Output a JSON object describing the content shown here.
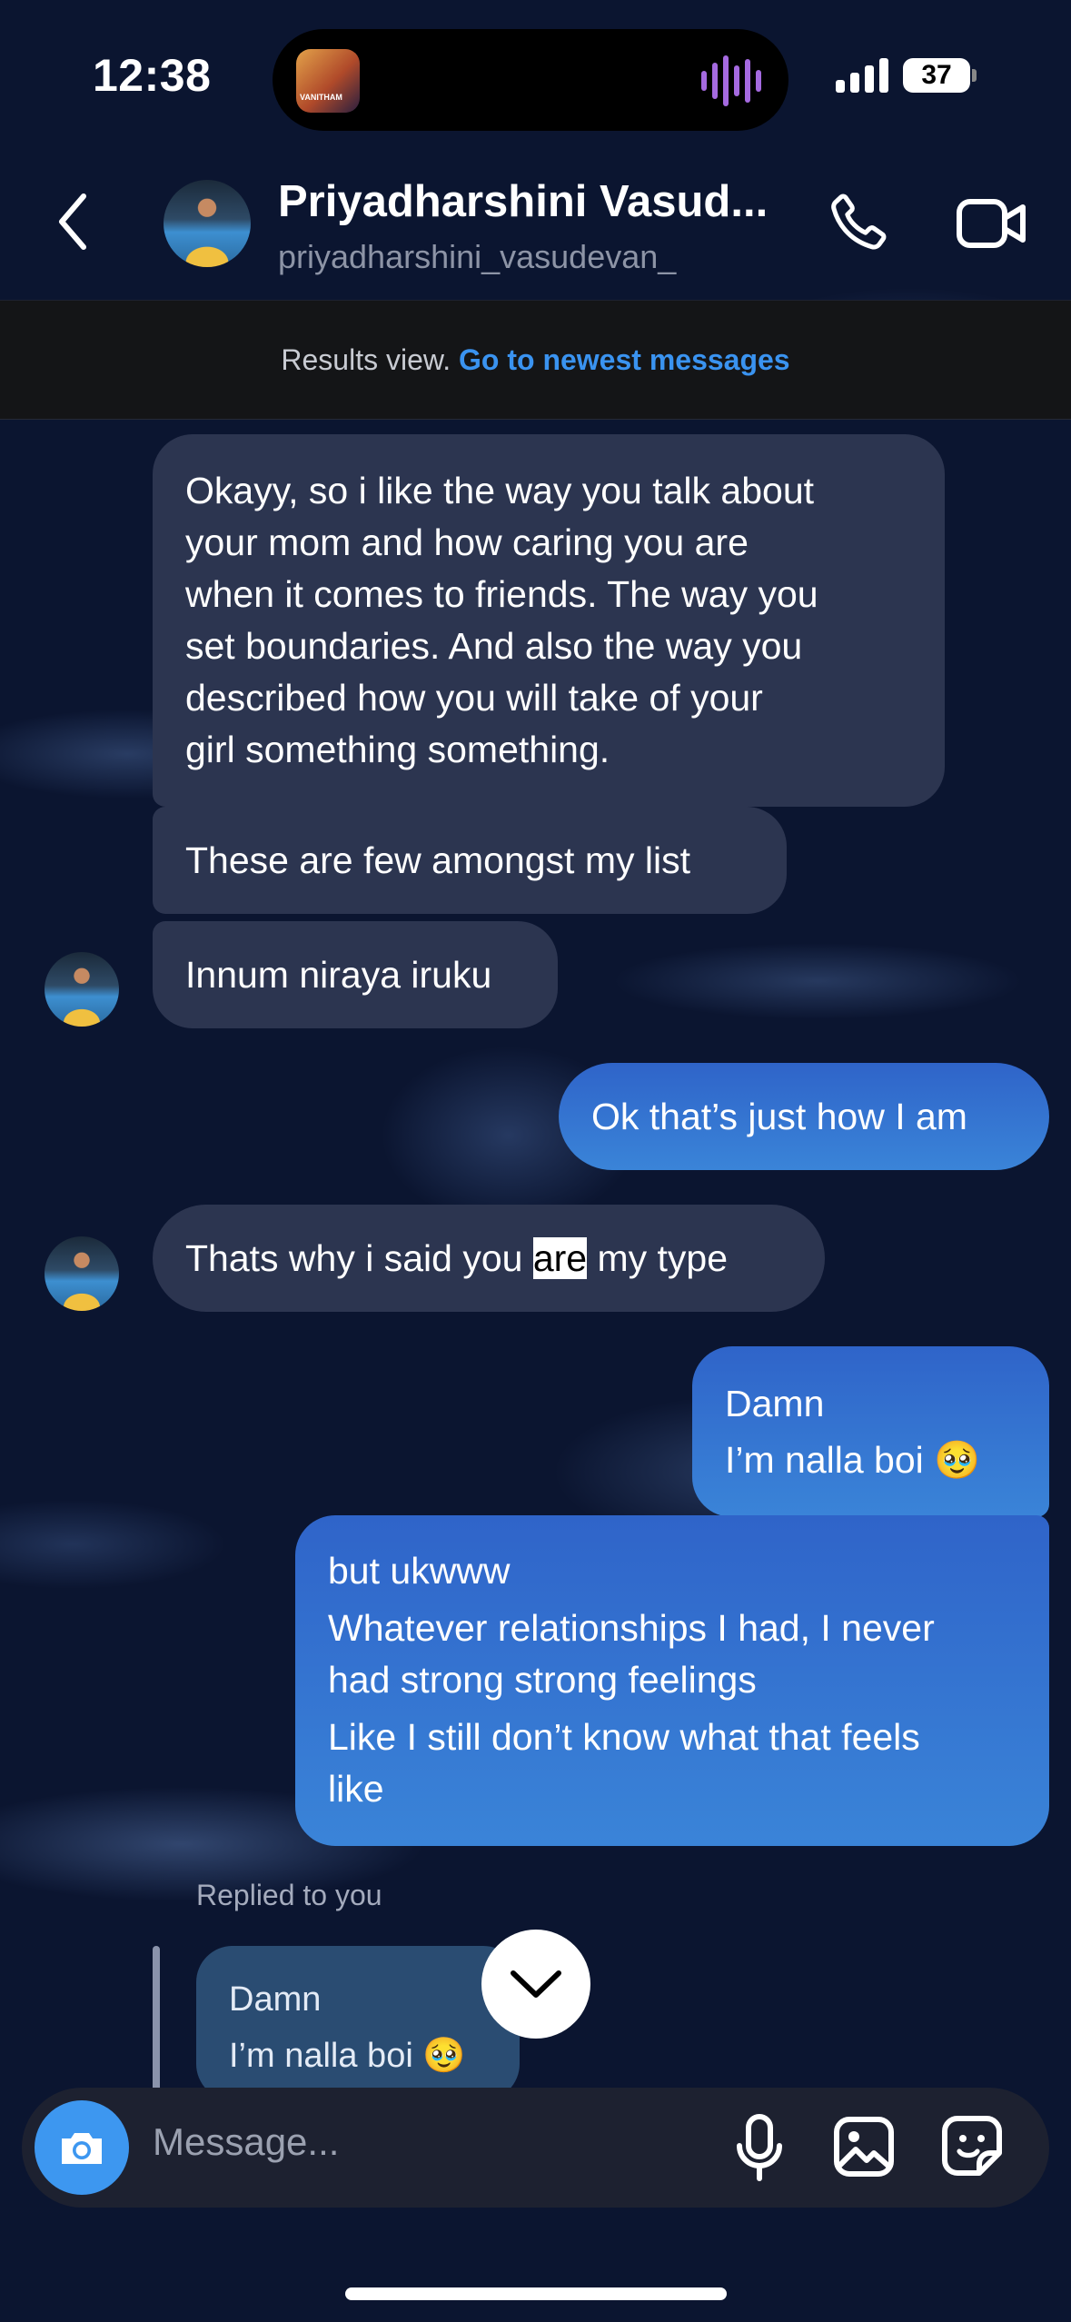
{
  "status_bar": {
    "time": "12:38",
    "now_playing_art_label": "VANITHAM",
    "battery": "37"
  },
  "header": {
    "name": "Priyadharshini Vasud...",
    "username": "priyadharshini_vasudevan_",
    "icons": [
      "back-icon",
      "phone-icon",
      "video-icon"
    ]
  },
  "results_banner": {
    "text": "Results view.",
    "link": "Go to newest messages"
  },
  "messages": [
    {
      "direction": "in",
      "lines": [
        "Okayy, so i like the way you talk about",
        "your mom and how caring you are",
        "when it comes to friends. The way you",
        "set boundaries. And also the way you",
        "described how you will take of your",
        "girl something something."
      ]
    },
    {
      "direction": "in",
      "text": "These are few amongst my list"
    },
    {
      "direction": "in",
      "text": "Innum niraya iruku"
    },
    {
      "direction": "out",
      "text": "Ok that’s just how I am"
    },
    {
      "direction": "in",
      "before": "Thats why i said you ",
      "highlight": "are",
      "after": " my type"
    },
    {
      "direction": "out",
      "lines": [
        "Damn",
        "I’m nalla boi 🥹"
      ]
    },
    {
      "direction": "out",
      "lines": [
        "but ukwww",
        "Whatever relationships I had, I never",
        "had strong strong feelings",
        "Like I still don’t know what that feels",
        "like"
      ]
    }
  ],
  "reply": {
    "label": "Replied to you",
    "lines": [
      "Damn",
      "I’m nalla boi 🥹"
    ]
  },
  "composer": {
    "placeholder": "Message...",
    "icons": [
      "camera-icon",
      "microphone-icon",
      "gallery-icon",
      "sticker-icon"
    ]
  },
  "colors": {
    "background": "#0b1530",
    "incoming_bubble": "#2c3550",
    "outgoing_bubble": "#3a84d8",
    "link": "#3a93f0",
    "camera_button": "#3d97f0"
  }
}
